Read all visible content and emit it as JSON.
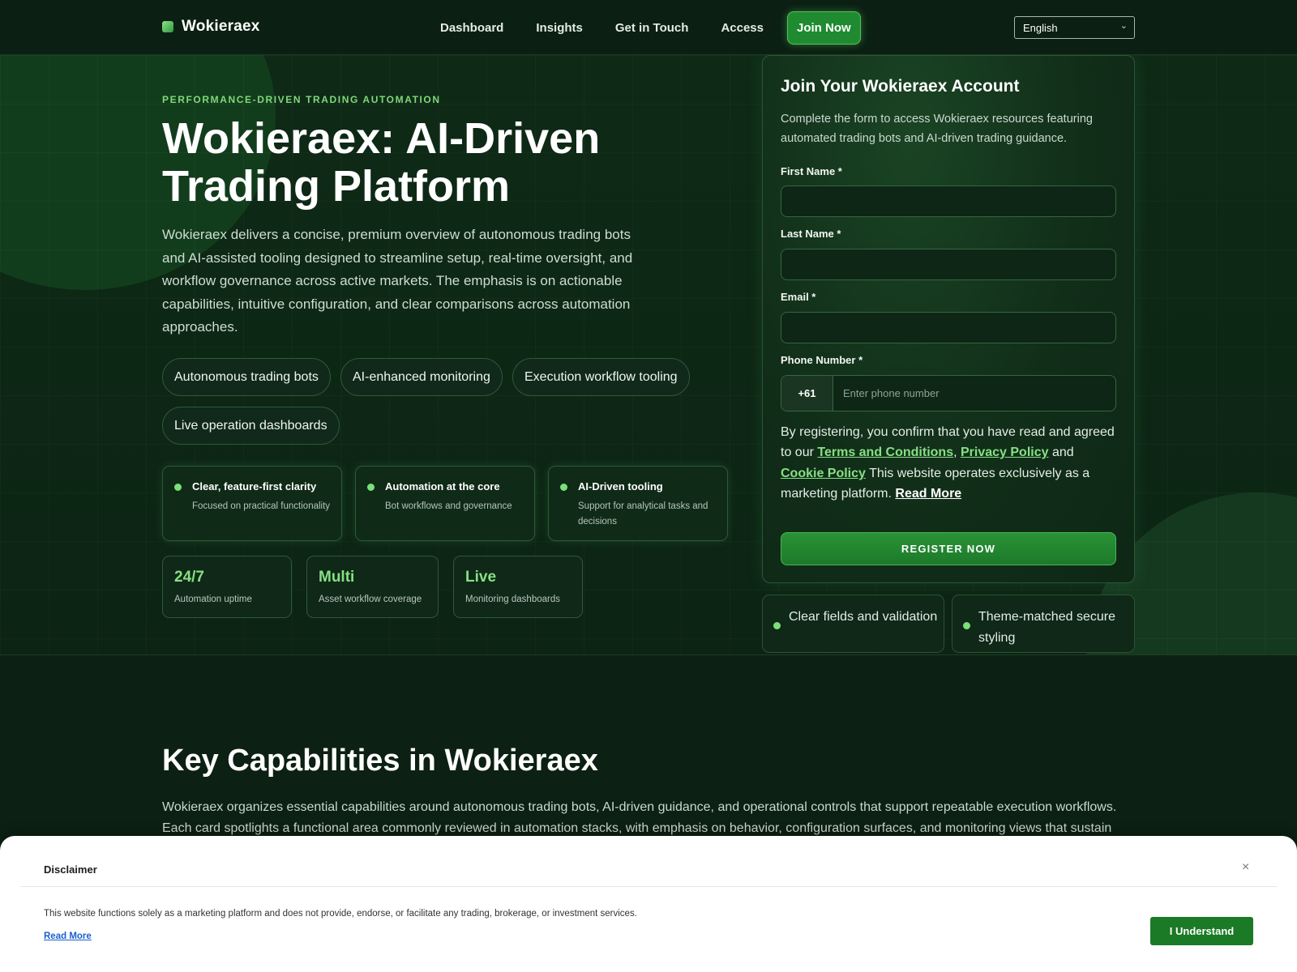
{
  "header": {
    "brand": "Wokieraex",
    "nav": [
      "Dashboard",
      "Insights",
      "Get in Touch",
      "Access"
    ],
    "join_label": "Join Now",
    "language": "English"
  },
  "hero": {
    "eyebrow": "PERFORMANCE-DRIVEN TRADING AUTOMATION",
    "title": "Wokieraex: AI-Driven Trading Platform",
    "description": "Wokieraex delivers a concise, premium overview of autonomous trading bots and AI-assisted tooling designed to streamline setup, real-time oversight, and workflow governance across active markets. The emphasis is on actionable capabilities, intuitive configuration, and clear comparisons across automation approaches.",
    "chips": [
      "Autonomous trading bots",
      "AI-enhanced monitoring",
      "Execution workflow tooling",
      "Live operation dashboards"
    ],
    "features": [
      {
        "title": "Clear, feature-first clarity",
        "desc": "Focused on practical functionality"
      },
      {
        "title": "Automation at the core",
        "desc": "Bot workflows and governance"
      },
      {
        "title": "AI-Driven tooling",
        "desc": "Support for analytical tasks and decisions"
      }
    ],
    "stats": [
      {
        "value": "24/7",
        "label": "Automation uptime"
      },
      {
        "value": "Multi",
        "label": "Asset workflow coverage"
      },
      {
        "value": "Live",
        "label": "Monitoring dashboards"
      }
    ]
  },
  "form": {
    "title": "Join Your Wokieraex Account",
    "subtitle": "Complete the form to access Wokieraex resources featuring automated trading bots and AI-driven trading guidance.",
    "first_name_label": "First Name *",
    "last_name_label": "Last Name *",
    "email_label": "Email *",
    "phone_label": "Phone Number *",
    "phone_code": "+61",
    "phone_placeholder": "Enter phone number",
    "consent_prefix": "By registering, you confirm that you have read and agreed to our",
    "terms": "Terms and Conditions",
    "privacy": "Privacy Policy",
    "and": "and",
    "cookie": "Cookie Policy",
    "consent_suffix": "This website operates exclusively as a marketing platform.",
    "read_more": "Read More",
    "register_label": "REGISTER NOW",
    "badges": [
      "Clear fields and validation",
      "Theme-matched secure styling"
    ]
  },
  "capabilities": {
    "title": "Key Capabilities in Wokieraex",
    "description": "Wokieraex organizes essential capabilities around autonomous trading bots, AI-driven guidance, and operational controls that support repeatable execution workflows. Each card spotlights a functional area commonly reviewed in automation stacks, with emphasis on behavior, configuration surfaces, and monitoring views that sustain"
  },
  "disclaimer": {
    "title": "Disclaimer",
    "close": "×",
    "text": "This website functions solely as a marketing platform and does not provide, endorse, or facilitate any trading, brokerage, or investment services.",
    "read_more": "Read More",
    "button": "I Understand"
  }
}
